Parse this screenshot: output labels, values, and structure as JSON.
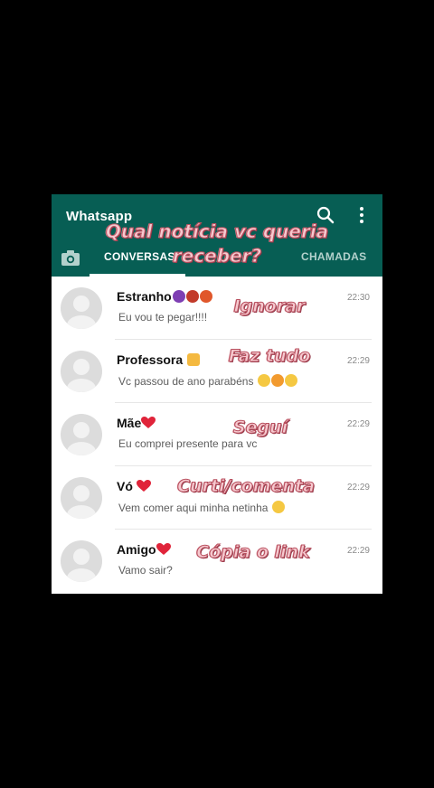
{
  "header": {
    "app_title": "Whatsapp",
    "tabs": {
      "conversas": "CONVERSAS",
      "chamadas": "CHAMADAS"
    }
  },
  "overlay": {
    "question_line1": "Qual notícia vc queria",
    "question_line2": "receber?"
  },
  "chats": [
    {
      "name": "Estranho",
      "message": "Eu vou te pegar!!!!",
      "time": "22:30",
      "overlay": "Ignorar",
      "emojis": [
        "devil-emoji",
        "demon-emoji",
        "angry-emoji"
      ]
    },
    {
      "name": "Professora",
      "message": "Vc passou de ano parabéns",
      "time": "22:29",
      "overlay": "Faz tudo",
      "emojis": [
        "teacher-emoji"
      ],
      "message_emojis": [
        "clap-emoji",
        "heart-eyes-emoji",
        "clap-emoji"
      ]
    },
    {
      "name": "Mãe",
      "message": "Eu comprei presente para vc",
      "time": "22:29",
      "overlay": "Seguí",
      "emojis": [
        "heart-emoji"
      ]
    },
    {
      "name": "Vó",
      "message": "Vem comer aqui minha netinha",
      "time": "22:29",
      "overlay": "Curti/comenta",
      "emojis": [
        "heart-emoji"
      ],
      "message_emojis": [
        "wink-emoji"
      ]
    },
    {
      "name": "Amigo",
      "message": "Vamo sair?",
      "time": "22:29",
      "overlay": "Cópia o link",
      "emojis": [
        "heart-emoji"
      ]
    }
  ],
  "colors": {
    "header": "#075e54",
    "overlay_text": "#f6c9cf",
    "overlay_outline": "#b8505f"
  }
}
